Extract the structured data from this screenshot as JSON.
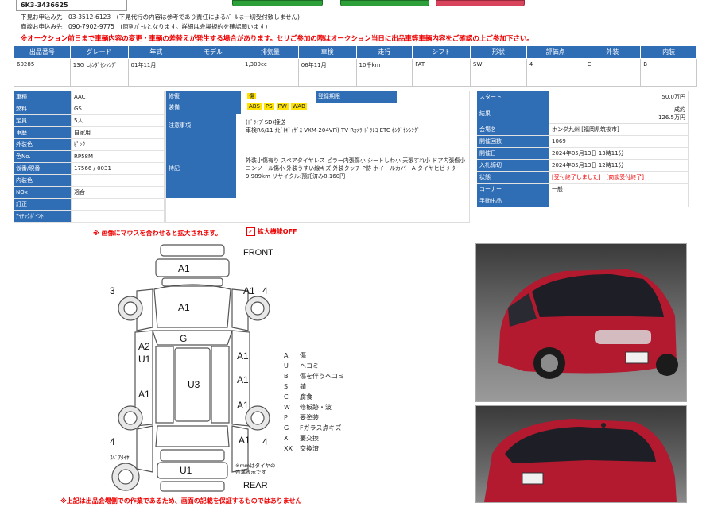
{
  "header": {
    "lot_code": "6K3-3436625",
    "contacts": [
      {
        "label": "下見お申込み先",
        "value": "03-3512-6123",
        "note": "(下見代行の内容は参考であり責任によるﾊﾞｰﾙは一切受付致しません)"
      },
      {
        "label": "商談お申込み先",
        "value": "090-7902-9775",
        "note": "(原則ﾊﾞｰﾙとなります。詳細は会場規約を確認願います)"
      }
    ],
    "warning": "※オークション前日まで車輌内容の変更・車輌の差替えが発生する場合があります。セリご参加の際はオークション当日に出品車等車輌内容をご確認の上ご参加下さい。"
  },
  "main_table": {
    "headers": [
      "出品番号",
      "グレード",
      "年式",
      "モデル",
      "排気量",
      "車検",
      "走行",
      "シフト",
      "形状",
      "評価点",
      "外装",
      "内装"
    ],
    "row": [
      "60285",
      "13G Lﾎﾝﾀﾞｾﾝｼﾝｸﾞ",
      "01年11月",
      "",
      "1,300cc",
      "06年11月",
      "10千km",
      "FAT",
      "SW",
      "4",
      "C",
      "B"
    ]
  },
  "specs": [
    {
      "label": "車種",
      "value": "AAC"
    },
    {
      "label": "燃料",
      "value": "GS"
    },
    {
      "label": "定員",
      "value": "5人"
    },
    {
      "label": "車歴",
      "value": "自家用"
    },
    {
      "label": "外装色",
      "value": "ﾋﾟﾝｸ"
    },
    {
      "label": "色No.",
      "value": "RP58M"
    },
    {
      "label": "仮番/現番",
      "value": "17566 / 0031"
    },
    {
      "label": "内装色",
      "value": ""
    },
    {
      "label": "NOx",
      "value": "適合"
    },
    {
      "label": "訂正",
      "value": ""
    },
    {
      "label": "ｱｲﾃｯｸﾎﾟｲﾝﾄ",
      "value": ""
    }
  ],
  "equip": {
    "repair_label": "修復",
    "repair_value": "傷",
    "certificate_label": "登録期限",
    "equipment_label": "装備",
    "equipment_items": [
      "ABS",
      "PS",
      "PW",
      "WAB"
    ],
    "notes_label": "注意事項",
    "notes_lines": [
      "(ﾄﾞﾗｲﾌﾞSD)接送",
      "車検R6/11 ﾅﾋﾞ(ｷﾞｬｻﾞｽ VXM-204VFi) TV Rｶﾒﾗ ﾄﾞﾗﾚｺ ETC ﾎﾝﾀﾞｾﾝｼﾝｸﾞ"
    ],
    "remarks_label": "特記",
    "remarks": "外装小傷有り スペアタイヤレス ピラー内張傷小 シートしわ小 天張すれ小 ドア内張傷小 コンソール傷小 外装うすい線キズ 外装タッチ P跡 ホイールカバーA タイヤヒビ ﾒｰﾀｰ9,989km リサイクル:預託済み8,160円"
  },
  "auction": [
    {
      "label": "スタート",
      "value": "50.0万円"
    },
    {
      "label": "結果",
      "value": "成約",
      "value2": "126.5万円"
    },
    {
      "label": "会場名",
      "value": "ホンダ九州 [福岡県筑後市]"
    },
    {
      "label": "開催回数",
      "value": "1069"
    },
    {
      "label": "開催日",
      "value": "2024年05月13日 13時11分"
    },
    {
      "label": "入札締切",
      "value": "2024年05月13日 12時11分"
    },
    {
      "label": "状態",
      "value": "[受付終了しました]",
      "value2": "[商談受付終了]"
    },
    {
      "label": "コーナー",
      "value": "一般"
    },
    {
      "label": "手動出品",
      "value": ""
    }
  ],
  "zoom": {
    "notice": "※ 画像にマウスを合わせると拡大されます。",
    "toggle": "拡大機能OFF"
  },
  "diagram": {
    "front": "FRONT",
    "rear": "REAR",
    "spare": "ｽﾍﾟｱﾀｲﾔ",
    "tire_note": "※mmはタイヤの残溝表示です",
    "marks": {
      "m1": "A1",
      "m2": "A1",
      "m3": "A1",
      "m4": "G",
      "m5": "A2",
      "m6": "U1",
      "m7": "A1",
      "m8": "A1",
      "m9": "A1",
      "m10": "U3",
      "m11": "A1",
      "m12": "A1",
      "m13": "U1",
      "n1": "3",
      "n2": "4",
      "n3": "4",
      "n4": "4"
    }
  },
  "legend": [
    {
      "code": "A",
      "desc": "傷"
    },
    {
      "code": "U",
      "desc": "ヘコミ"
    },
    {
      "code": "B",
      "desc": "傷を伴うヘコミ"
    },
    {
      "code": "S",
      "desc": "錆"
    },
    {
      "code": "C",
      "desc": "腐食"
    },
    {
      "code": "W",
      "desc": "修板跡・波"
    },
    {
      "code": "P",
      "desc": "要塗装"
    },
    {
      "code": "G",
      "desc": "Fガラス点キズ"
    },
    {
      "code": "X",
      "desc": "要交換"
    },
    {
      "code": "XX",
      "desc": "交換済"
    }
  ],
  "footer_warning": "※上記は出品会場側での作業であるため、画面の記載を保証するものではありません",
  "colors": {
    "header_blue": "#2f6db5",
    "alert_red": "#e00000",
    "highlight": "#ffe200",
    "car_red": "#b3192f"
  }
}
